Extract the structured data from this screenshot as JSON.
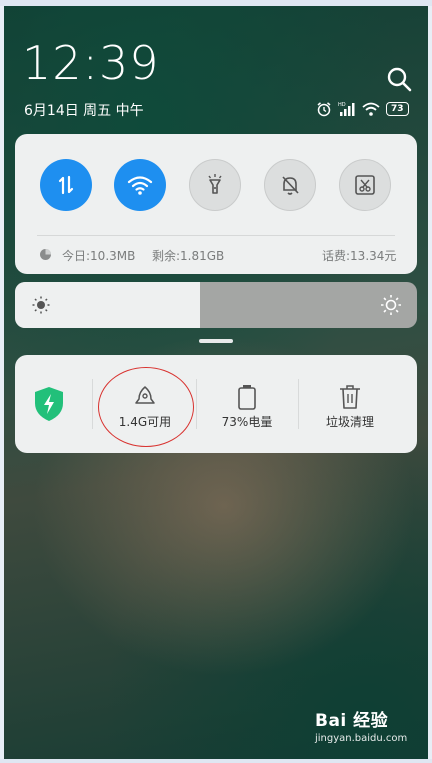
{
  "lockscreen": {
    "time": "12:39",
    "date": "6月14日 周五 中午",
    "battery_level": "73"
  },
  "quick_settings": {
    "toggles": [
      {
        "name": "mobile-data",
        "state": "on"
      },
      {
        "name": "wifi",
        "state": "on"
      },
      {
        "name": "flashlight",
        "state": "off"
      },
      {
        "name": "mute",
        "state": "off"
      },
      {
        "name": "screenshot",
        "state": "off"
      }
    ],
    "data_today": "今日:10.3MB",
    "data_remaining": "剩余:1.81GB",
    "balance": "话费:13.34元"
  },
  "brightness": {
    "level": 0.46
  },
  "shortcuts": {
    "memory_label": "1.4G可用",
    "battery_label": "73%电量",
    "cleanup_label": "垃圾清理"
  },
  "watermark": {
    "brand": "Bai 经验",
    "url": "jingyan.baidu.com"
  },
  "colors": {
    "accent": "#1e8ff0",
    "security_green": "#22c07a",
    "annotation_red": "#d8322f"
  }
}
